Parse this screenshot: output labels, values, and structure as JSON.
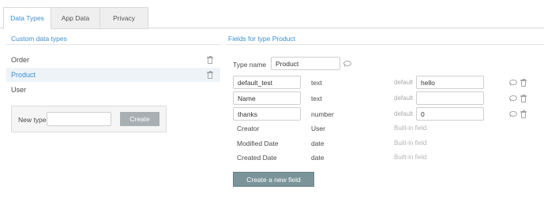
{
  "tabs": [
    {
      "label": "Data Types",
      "active": true
    },
    {
      "label": "App Data",
      "active": false
    },
    {
      "label": "Privacy",
      "active": false
    }
  ],
  "left_panel": {
    "header": "Custom data types",
    "types": [
      {
        "label": "Order",
        "selected": false
      },
      {
        "label": "Product",
        "selected": true
      },
      {
        "label": "User",
        "selected": false
      }
    ],
    "new_type": {
      "label": "New type",
      "value": "",
      "button": "Create"
    }
  },
  "right_panel": {
    "header": "Fields for type Product",
    "type_name_label": "Type name",
    "type_name_value": "Product",
    "default_label": "default",
    "editable_fields": [
      {
        "name": "default_test",
        "type": "text",
        "default": "hello"
      },
      {
        "name": "Name",
        "type": "text",
        "default": ""
      },
      {
        "name": "thanks",
        "type": "number",
        "default": "0"
      }
    ],
    "builtin_fields": [
      {
        "name": "Creator",
        "type": "User",
        "note": "Built-in field"
      },
      {
        "name": "Modified Date",
        "type": "date",
        "note": "Built-in field"
      },
      {
        "name": "Created Date",
        "type": "date",
        "note": "Built-in field"
      }
    ],
    "create_field_button": "Create a new field"
  },
  "colors": {
    "accent": "#3a8fd0",
    "selected_row_bg": "#eef3f8",
    "create_button_bg": "#a8b0b3",
    "create_field_button_bg": "#7b949a",
    "icon_gray": "#a6a6a6"
  },
  "icons": [
    "trash-icon",
    "comment-icon"
  ]
}
